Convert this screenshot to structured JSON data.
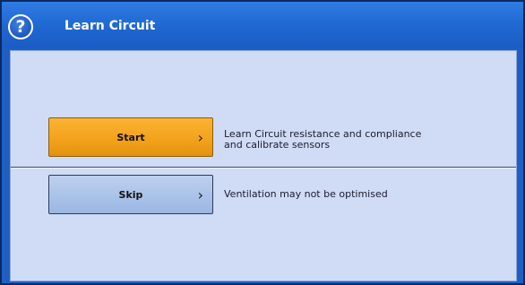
{
  "window": {
    "title": "Learn Circuit",
    "help_glyph": "?"
  },
  "actions": {
    "start": {
      "label": "Start",
      "chevron": "›",
      "description_line1": "Learn Circuit resistance and compliance",
      "description_line2": "and calibrate sensors"
    },
    "skip": {
      "label": "Skip",
      "chevron": "›",
      "description": "Ventilation may not be optimised"
    }
  },
  "colors": {
    "start_button": "#f2a11a",
    "skip_button": "#a9c1e8",
    "titlebar": "#2068d2",
    "content_bg": "#d0dcf6"
  },
  "icons": {
    "help": "help-icon",
    "chevron": "chevron-right-icon"
  }
}
